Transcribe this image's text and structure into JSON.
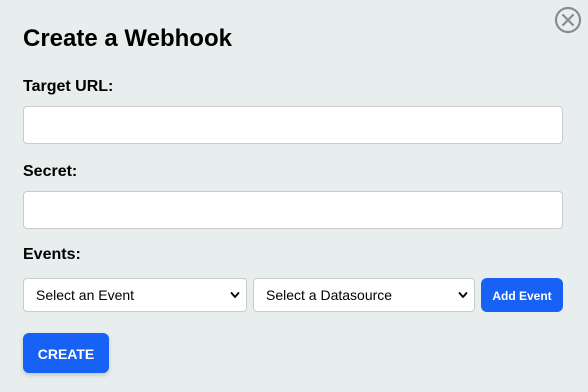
{
  "dialog": {
    "title": "Create a Webhook",
    "close_icon": "close-circle-icon"
  },
  "fields": {
    "target_url": {
      "label": "Target URL:",
      "value": "",
      "placeholder": ""
    },
    "secret": {
      "label": "Secret:",
      "value": "",
      "placeholder": ""
    }
  },
  "events": {
    "label": "Events:",
    "event_select": {
      "selected": "Select an Event",
      "icon": "chevron-down-icon"
    },
    "datasource_select": {
      "selected": "Select a Datasource",
      "icon": "chevron-down-icon"
    },
    "add_button_label": "Add Event"
  },
  "actions": {
    "create_label": "CREATE"
  },
  "colors": {
    "background": "#e8eeee",
    "primary": "#1761f5",
    "input_border": "#c9cccc",
    "close_icon": "#8a8d8d"
  }
}
